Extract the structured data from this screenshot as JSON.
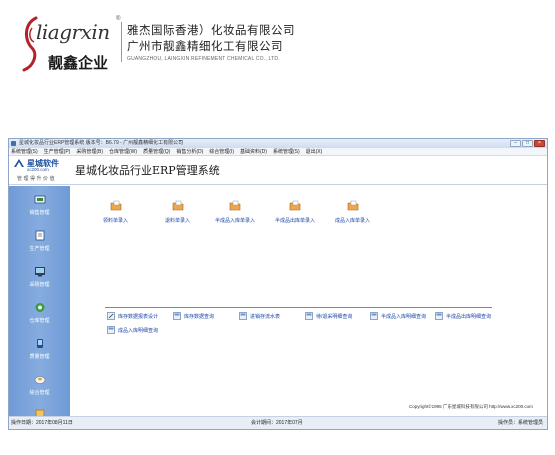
{
  "company": {
    "logo_script": "liagrxin",
    "logo_reg": "®",
    "logo_cn": "靓鑫企业",
    "name_hk": "雅杰国际香港）化妆品有限公司",
    "name_gz": "广州市靓鑫精细化工有限公司",
    "name_en": "GUANGZHOU, LAINGXIN REFINEMENT CHEMICAL CO., LTD."
  },
  "window": {
    "title": "星城化妆品行业ERP管理系统 版本号：B6.79 - 广州靓鑫精细化工有限公司",
    "buttons": [
      "–",
      "□",
      "×"
    ]
  },
  "menu": [
    "系统管理(S)",
    "生产管理(P)",
    "采购管理(B)",
    "仓库管理(W)",
    "质量管理(Q)",
    "销售分析(D)",
    "综合管理(I)",
    "基础资料(D)",
    "系统管理(S)",
    "退出(X)"
  ],
  "brand": {
    "name": "星城软件",
    "url": "xc200.com",
    "slogan": "管理得升价值"
  },
  "system_title": "星城化妆品行业ERP管理系统",
  "sidebar": {
    "items": [
      {
        "label": "销售管理",
        "icon": "sales-icon"
      },
      {
        "label": "生产管理",
        "icon": "production-icon"
      },
      {
        "label": "采购管理",
        "icon": "purchase-icon"
      },
      {
        "label": "仓库管理",
        "icon": "warehouse-icon"
      },
      {
        "label": "质量管理",
        "icon": "quality-icon"
      },
      {
        "label": "综合管理",
        "icon": "general-icon"
      }
    ]
  },
  "quick_actions": [
    {
      "label": "领料单录入",
      "icon": "folder-icon"
    },
    {
      "label": "退料单录入",
      "icon": "folder-icon"
    },
    {
      "label": "半成品入库单录入",
      "icon": "folder-icon"
    },
    {
      "label": "半成品出库单录入",
      "icon": "folder-icon"
    },
    {
      "label": "成品入库单录入",
      "icon": "folder-icon"
    }
  ],
  "reports": [
    {
      "label": "库存数据报表设计",
      "icon": "report-icon"
    },
    {
      "label": "库存数据查询",
      "icon": "report-icon"
    },
    {
      "label": "进销存流水表",
      "icon": "report-icon"
    },
    {
      "label": "待/退采明细查询",
      "icon": "report-icon"
    },
    {
      "label": "半成品入库明细查询",
      "icon": "report-icon"
    },
    {
      "label": "半成品出库明细查询",
      "icon": "report-icon"
    },
    {
      "label": "成品入库明细查询",
      "icon": "report-icon"
    }
  ],
  "copyright": "Copyright©1995 广东星城科技有限公司 http://www.xc200.com",
  "status": {
    "date": "操作日期：2017年08月11日",
    "period": "会计期间：2017年07月",
    "operator": "操作员：系统管理员"
  },
  "colors": {
    "sidebar": "#7aa3da",
    "link": "#1d47a8",
    "rule": "#5b8fd4",
    "brand_blue": "#1d4e9e"
  }
}
